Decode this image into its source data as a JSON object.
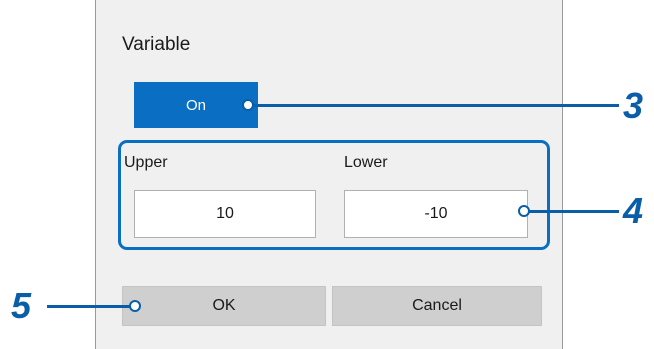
{
  "dialog": {
    "title": "Variable",
    "toggle_label": "On",
    "upper_label": "Upper",
    "lower_label": "Lower",
    "upper_value": "10",
    "lower_value": "-10",
    "ok_label": "OK",
    "cancel_label": "Cancel"
  },
  "callouts": {
    "toggle_number": "3",
    "fields_number": "4",
    "ok_number": "5"
  },
  "colors": {
    "accent": "#0a6fc2",
    "callout": "#0a5ea8",
    "dialog_bg": "#f0f0f0",
    "button_bg": "#cfcfcf"
  }
}
